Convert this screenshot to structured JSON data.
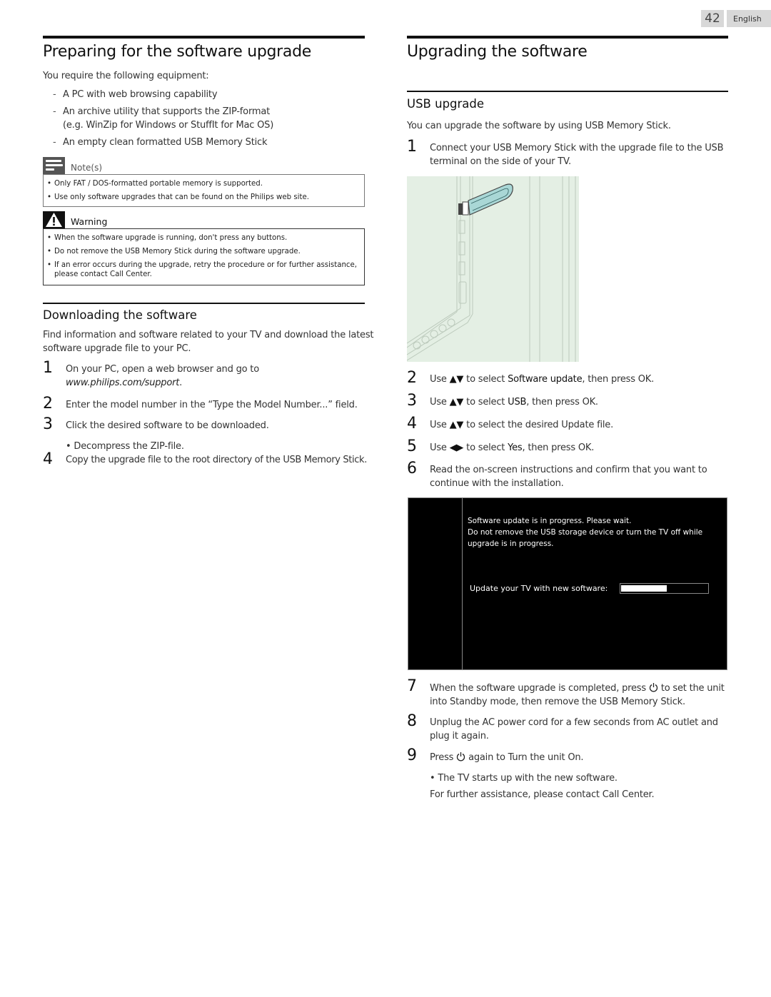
{
  "page": {
    "number": "42",
    "language": "English"
  },
  "left": {
    "title": "Preparing for the software upgrade",
    "intro": "You require the following equipment:",
    "equipment": [
      {
        "line1": "A PC with web browsing capability"
      },
      {
        "line1": "An archive utility that supports the ZIP-format",
        "line2": "(e.g. WinZip for Windows or StuffIt for Mac OS)"
      },
      {
        "line1": "An empty clean formatted USB Memory Stick"
      }
    ],
    "notes": {
      "label": "Note(s)",
      "icon": "note-icon",
      "items": [
        "Only FAT / DOS-formatted portable memory is supported.",
        "Use only software upgrades that can be found on the Philips web site."
      ]
    },
    "warning": {
      "label": "Warning",
      "icon": "warning-triangle-icon",
      "items": [
        "When the software upgrade is running, don't press any buttons.",
        "Do not remove the USB Memory Stick during the software upgrade.",
        "If an error occurs during the upgrade, retry the procedure or for further assistance, please contact Call Center."
      ]
    },
    "download": {
      "title": "Downloading the software",
      "intro_line1": "Find information and software related to your TV and download the latest",
      "intro_line2": "software upgrade file to your PC.",
      "steps": [
        {
          "num": "1",
          "text": "On your PC, open a web browser and go to",
          "url": "www.philips.com/support",
          "after": "."
        },
        {
          "num": "2",
          "text": "Enter the model number in the “Type the Model Number...” field."
        },
        {
          "num": "3",
          "text": "Click the desired software to be downloaded.",
          "sub": "Decompress the ZIP-file."
        },
        {
          "num": "4",
          "text": "Copy the upgrade file to the root directory of the USB Memory Stick."
        }
      ]
    }
  },
  "right": {
    "title": "Upgrading the software",
    "usb": {
      "title": "USB upgrade",
      "intro": "You can upgrade the software by using USB Memory Stick.",
      "step1": {
        "num": "1",
        "line1": "Connect your USB Memory Stick with the upgrade file to the USB",
        "line2": "terminal on the side of your TV."
      },
      "illustration": "usb-stick-into-tv-side-terminal",
      "steps": [
        {
          "num": "2",
          "pre": "Use",
          "arrows": "▲▼",
          "mid": "to select",
          "hl": "Software update",
          "post": ", then press OK."
        },
        {
          "num": "3",
          "pre": "Use",
          "arrows": "▲▼",
          "mid": "to select",
          "hl": "USB",
          "post": ", then press OK."
        },
        {
          "num": "4",
          "pre": "Use",
          "arrows": "▲▼",
          "mid": "to select the desired Update file.",
          "hl": "",
          "post": ""
        },
        {
          "num": "5",
          "pre": "Use",
          "arrows": "◀▶",
          "mid": "to select",
          "hl": "Yes",
          "post": ", then press OK."
        }
      ],
      "step6": {
        "num": "6",
        "line1": "Read the on-screen instructions and confirm that you want to",
        "line2": "continue with the installation."
      },
      "screen": {
        "line1": "Software update is in progress. Please wait.",
        "line2": "Do not remove the USB storage device or turn the TV off  while",
        "line3": "upgrade is in progress.",
        "progress_label": "Update your TV with new software:",
        "progress": 0.53
      },
      "step7": {
        "num": "7",
        "line1a": "When the software upgrade is completed, press",
        "line1b": "to set the unit",
        "line2": "into Standby mode, then remove the USB Memory Stick."
      },
      "step8": {
        "num": "8",
        "line1": "Unplug the AC power cord for a few seconds from AC outlet and",
        "line2": "plug it again."
      },
      "step9": {
        "num": "9",
        "pre": "Press",
        "post": "again to Turn the unit On.",
        "sub": "The TV starts up with the new software."
      },
      "footer": "For further assistance, please contact Call Center."
    }
  }
}
